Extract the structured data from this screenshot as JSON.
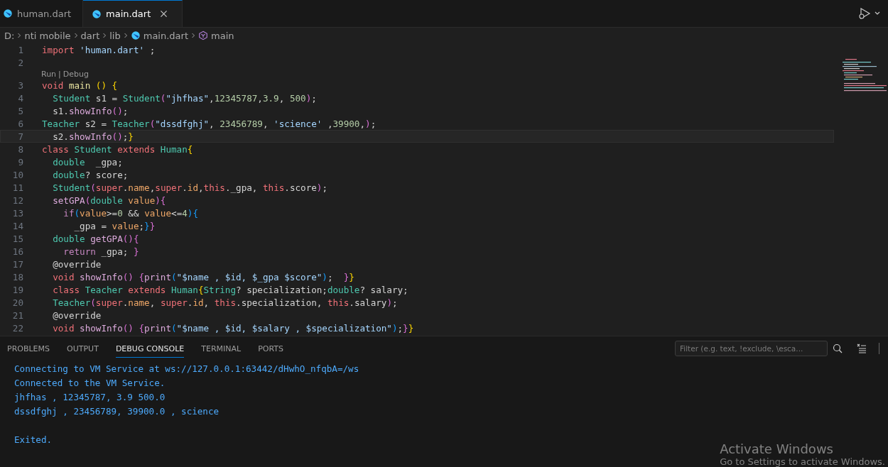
{
  "tabs": [
    {
      "label": "human.dart",
      "selected": false,
      "closable": false
    },
    {
      "label": "main.dart",
      "selected": true,
      "closable": true
    }
  ],
  "breadcrumb": [
    {
      "label": "D:",
      "kind": "folder"
    },
    {
      "label": "nti mobile",
      "kind": "folder"
    },
    {
      "label": "dart",
      "kind": "folder"
    },
    {
      "label": "lib",
      "kind": "folder"
    },
    {
      "label": "main.dart",
      "kind": "file"
    },
    {
      "label": "main",
      "kind": "symbol"
    }
  ],
  "lines": [
    {
      "number": "1",
      "current": false,
      "tokens": [
        {
          "kind": "kw",
          "text": "import"
        },
        {
          "kind": "str",
          "text": " 'human.dart'"
        },
        {
          "kind": "plain",
          "text": " ;"
        }
      ]
    },
    {
      "number": "2",
      "current": false,
      "code_lens": {
        "links": [
          "Run",
          "Debug"
        ],
        "separator": "|"
      }
    },
    {
      "number": "3",
      "current": false,
      "tokens": [
        {
          "kind": "kw",
          "text": "void"
        },
        {
          "kind": "fn2",
          "text": " main "
        },
        {
          "kind": "b1",
          "text": "() {"
        }
      ]
    },
    {
      "number": "4",
      "current": false,
      "tokens": [
        {
          "kind": "type",
          "text": "  Student"
        },
        {
          "kind": "plain",
          "text": " s1 = "
        },
        {
          "kind": "type",
          "text": "Student"
        },
        {
          "kind": "b2",
          "text": "("
        },
        {
          "kind": "str",
          "text": "\"jhfhas\""
        },
        {
          "kind": "plain",
          "text": ","
        },
        {
          "kind": "num",
          "text": "12345787"
        },
        {
          "kind": "plain",
          "text": ","
        },
        {
          "kind": "num",
          "text": "3.9"
        },
        {
          "kind": "plain",
          "text": ","
        },
        {
          "kind": "num",
          "text": " 500"
        },
        {
          "kind": "b2",
          "text": ")"
        },
        {
          "kind": "plain",
          "text": ";"
        }
      ]
    },
    {
      "number": "5",
      "current": false,
      "tokens": [
        {
          "kind": "plain",
          "text": "  s1."
        },
        {
          "kind": "fn",
          "text": "showInfo"
        },
        {
          "kind": "b2",
          "text": "()"
        },
        {
          "kind": "plain",
          "text": ";"
        }
      ]
    },
    {
      "number": "6",
      "current": false,
      "tokens": [
        {
          "kind": "type",
          "text": "Teacher"
        },
        {
          "kind": "plain",
          "text": " s2 = "
        },
        {
          "kind": "type",
          "text": "Teacher"
        },
        {
          "kind": "b2",
          "text": "("
        },
        {
          "kind": "str",
          "text": "\"dssdfghj\""
        },
        {
          "kind": "plain",
          "text": ","
        },
        {
          "kind": "num",
          "text": " 23456789"
        },
        {
          "kind": "plain",
          "text": ","
        },
        {
          "kind": "str",
          "text": " 'science'"
        },
        {
          "kind": "plain",
          "text": " ,"
        },
        {
          "kind": "num",
          "text": "39900"
        },
        {
          "kind": "plain",
          "text": ","
        },
        {
          "kind": "b2",
          "text": ")"
        },
        {
          "kind": "plain",
          "text": ";"
        }
      ]
    },
    {
      "number": "7",
      "current": true,
      "tokens": [
        {
          "kind": "plain",
          "text": "  s2."
        },
        {
          "kind": "fn",
          "text": "showInfo"
        },
        {
          "kind": "b2",
          "text": "()"
        },
        {
          "kind": "plain",
          "text": ";"
        },
        {
          "kind": "b1",
          "text": "}"
        }
      ]
    },
    {
      "number": "8",
      "current": false,
      "tokens": [
        {
          "kind": "kw",
          "text": "class"
        },
        {
          "kind": "type",
          "text": " Student"
        },
        {
          "kind": "kw",
          "text": " extends"
        },
        {
          "kind": "type",
          "text": " Human"
        },
        {
          "kind": "b1",
          "text": "{"
        }
      ]
    },
    {
      "number": "9",
      "current": false,
      "tokens": [
        {
          "kind": "type",
          "text": "  double"
        },
        {
          "kind": "plain",
          "text": "  _gpa;"
        }
      ]
    },
    {
      "number": "10",
      "current": false,
      "tokens": [
        {
          "kind": "type",
          "text": "  double"
        },
        {
          "kind": "plain",
          "text": "? score;"
        }
      ]
    },
    {
      "number": "11",
      "current": false,
      "tokens": [
        {
          "kind": "type",
          "text": "  Student"
        },
        {
          "kind": "b2",
          "text": "("
        },
        {
          "kind": "kw",
          "text": "super"
        },
        {
          "kind": "plain",
          "text": "."
        },
        {
          "kind": "var",
          "text": "name"
        },
        {
          "kind": "plain",
          "text": ","
        },
        {
          "kind": "kw",
          "text": "super"
        },
        {
          "kind": "plain",
          "text": "."
        },
        {
          "kind": "var",
          "text": "id"
        },
        {
          "kind": "plain",
          "text": ","
        },
        {
          "kind": "kw",
          "text": "this"
        },
        {
          "kind": "plain",
          "text": "._gpa,"
        },
        {
          "kind": "kw",
          "text": " this"
        },
        {
          "kind": "plain",
          "text": ".score"
        },
        {
          "kind": "b2",
          "text": ")"
        },
        {
          "kind": "plain",
          "text": ";"
        }
      ]
    },
    {
      "number": "12",
      "current": false,
      "tokens": [
        {
          "kind": "fn",
          "text": "  setGPA"
        },
        {
          "kind": "b2",
          "text": "("
        },
        {
          "kind": "type",
          "text": "double"
        },
        {
          "kind": "var",
          "text": " value"
        },
        {
          "kind": "b2",
          "text": "){"
        }
      ]
    },
    {
      "number": "13",
      "current": false,
      "tokens": [
        {
          "kind": "kw2",
          "text": "    if"
        },
        {
          "kind": "b3",
          "text": "("
        },
        {
          "kind": "var",
          "text": "value"
        },
        {
          "kind": "plain",
          "text": ">="
        },
        {
          "kind": "num",
          "text": "0"
        },
        {
          "kind": "plain",
          "text": " && "
        },
        {
          "kind": "var",
          "text": "value"
        },
        {
          "kind": "plain",
          "text": "<="
        },
        {
          "kind": "num",
          "text": "4"
        },
        {
          "kind": "b3",
          "text": "){"
        }
      ]
    },
    {
      "number": "14",
      "current": false,
      "tokens": [
        {
          "kind": "plain",
          "text": "      _gpa = "
        },
        {
          "kind": "var",
          "text": "value"
        },
        {
          "kind": "plain",
          "text": ";"
        },
        {
          "kind": "b3",
          "text": "}"
        },
        {
          "kind": "b2",
          "text": "}"
        }
      ]
    },
    {
      "number": "15",
      "current": false,
      "tokens": [
        {
          "kind": "type",
          "text": "  double"
        },
        {
          "kind": "fn",
          "text": " getGPA"
        },
        {
          "kind": "b2",
          "text": "(){"
        }
      ]
    },
    {
      "number": "16",
      "current": false,
      "tokens": [
        {
          "kind": "kw2",
          "text": "    return"
        },
        {
          "kind": "plain",
          "text": " _gpa; "
        },
        {
          "kind": "b2",
          "text": "}"
        }
      ]
    },
    {
      "number": "17",
      "current": false,
      "tokens": [
        {
          "kind": "meta",
          "text": "  @override"
        }
      ]
    },
    {
      "number": "18",
      "current": false,
      "tokens": [
        {
          "kind": "kw",
          "text": "  void"
        },
        {
          "kind": "fn",
          "text": " showInfo"
        },
        {
          "kind": "b2",
          "text": "() {"
        },
        {
          "kind": "fn",
          "text": "print"
        },
        {
          "kind": "b3",
          "text": "("
        },
        {
          "kind": "str",
          "text": "\"$name , $id, $_gpa $score\""
        },
        {
          "kind": "b3",
          "text": ")"
        },
        {
          "kind": "plain",
          "text": ";  "
        },
        {
          "kind": "b2",
          "text": "}"
        },
        {
          "kind": "b1",
          "text": "}"
        }
      ]
    },
    {
      "number": "19",
      "current": false,
      "tokens": [
        {
          "kind": "kw",
          "text": "  class"
        },
        {
          "kind": "type",
          "text": " Teacher"
        },
        {
          "kind": "kw",
          "text": " extends"
        },
        {
          "kind": "type",
          "text": " Human"
        },
        {
          "kind": "b1",
          "text": "{"
        },
        {
          "kind": "type",
          "text": "String"
        },
        {
          "kind": "plain",
          "text": "? specialization;"
        },
        {
          "kind": "type",
          "text": "double"
        },
        {
          "kind": "plain",
          "text": "? salary;"
        }
      ]
    },
    {
      "number": "20",
      "current": false,
      "tokens": [
        {
          "kind": "type",
          "text": "  Teacher"
        },
        {
          "kind": "b2",
          "text": "("
        },
        {
          "kind": "kw",
          "text": "super"
        },
        {
          "kind": "plain",
          "text": "."
        },
        {
          "kind": "var",
          "text": "name"
        },
        {
          "kind": "plain",
          "text": ","
        },
        {
          "kind": "kw",
          "text": " super"
        },
        {
          "kind": "plain",
          "text": "."
        },
        {
          "kind": "var",
          "text": "id"
        },
        {
          "kind": "plain",
          "text": ","
        },
        {
          "kind": "kw",
          "text": " this"
        },
        {
          "kind": "plain",
          "text": ".specialization,"
        },
        {
          "kind": "kw",
          "text": " this"
        },
        {
          "kind": "plain",
          "text": ".salary"
        },
        {
          "kind": "b2",
          "text": ")"
        },
        {
          "kind": "plain",
          "text": ";"
        }
      ]
    },
    {
      "number": "21",
      "current": false,
      "tokens": [
        {
          "kind": "meta",
          "text": "  @override"
        }
      ]
    },
    {
      "number": "22",
      "current": false,
      "tokens": [
        {
          "kind": "kw",
          "text": "  void"
        },
        {
          "kind": "fn",
          "text": " showInfo"
        },
        {
          "kind": "b2",
          "text": "() {"
        },
        {
          "kind": "fn",
          "text": "print"
        },
        {
          "kind": "b3",
          "text": "("
        },
        {
          "kind": "str",
          "text": "\"$name , $id, $salary , $specialization\""
        },
        {
          "kind": "b3",
          "text": ")"
        },
        {
          "kind": "plain",
          "text": ";"
        },
        {
          "kind": "b2",
          "text": "}"
        },
        {
          "kind": "b1",
          "text": "}"
        }
      ]
    }
  ],
  "panel": {
    "tabs": [
      {
        "label": "PROBLEMS",
        "selected": false
      },
      {
        "label": "OUTPUT",
        "selected": false
      },
      {
        "label": "DEBUG CONSOLE",
        "selected": true
      },
      {
        "label": "TERMINAL",
        "selected": false
      },
      {
        "label": "PORTS",
        "selected": false
      }
    ],
    "filter": {
      "placeholder": "Filter (e.g. text, !exclude, \\esca..."
    },
    "console": [
      {
        "text": "Connecting to VM Service at ws://127.0.0.1:63442/dHwhO_nfqbA=/ws",
        "blank_before": false
      },
      {
        "text": "Connected to the VM Service.",
        "blank_before": false
      },
      {
        "text": "jhfhas , 12345787, 3.9 500.0",
        "blank_before": false
      },
      {
        "text": "dssdfghj , 23456789, 39900.0 , science",
        "blank_before": false
      },
      {
        "text": "Exited.",
        "blank_before": true
      }
    ]
  },
  "activation": {
    "title": "Activate Windows",
    "subtitle": "Go to Settings to activate Windows."
  }
}
